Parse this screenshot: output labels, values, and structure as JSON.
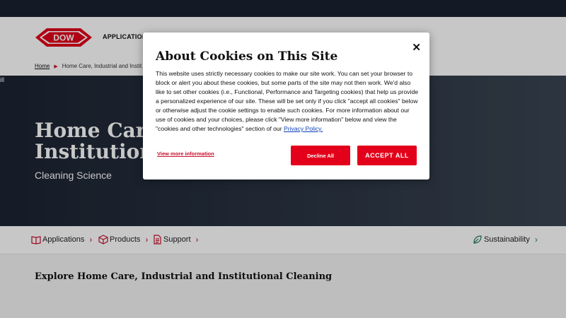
{
  "header": {
    "logo_text": "DOW",
    "nav_applications": "APPLICATIONS"
  },
  "breadcrumb": {
    "home": "Home",
    "current": "Home Care, Industrial and Instit"
  },
  "hero": {
    "tag": "ill",
    "title_line1": "Home Care",
    "title_line2": "Institutiona",
    "subtitle": "Cleaning Science"
  },
  "subnav": {
    "applications": "Applications",
    "products": "Products",
    "support": "Support",
    "sustainability": "Sustainability",
    "chevron": "›"
  },
  "explore_heading": "Explore Home Care, Industrial and Institutional Cleaning",
  "cookie_modal": {
    "title": "About Cookies on This Site",
    "close": "✕",
    "body": "This website uses strictly necessary cookies to make our site work. You can set your browser to block or alert you about these cookies, but some parts of the site may not then work. We'd also like to set other cookies (i.e., Functional, Performance and Targeting cookies) that help us provide a personalized experience of our site. These will be set only if you click \"accept all cookies\" below or otherwise adjust the cookie settings to enable such cookies. For more information about our use of cookies and your choices, please click \"View more information\" below and view the \"cookies and other technologies\" section of our",
    "privacy_link": "Privacy Policy.",
    "view_more": "View more information",
    "decline": "Decline All",
    "accept": "ACCEPT ALL"
  },
  "colors": {
    "brand_red": "#e2001a",
    "hero_dark": "#1b2433",
    "sustainability_green": "#1f7a55"
  }
}
